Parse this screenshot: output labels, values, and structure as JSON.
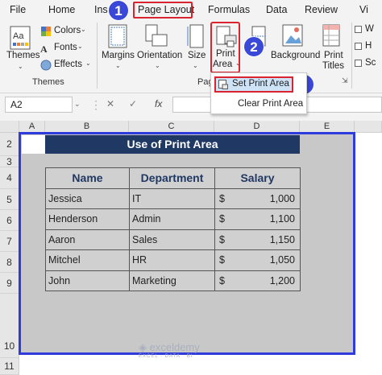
{
  "menu": {
    "items": [
      "File",
      "Home",
      "Ins",
      "Page Layout",
      "Formulas",
      "Data",
      "Review",
      "Vi"
    ],
    "active": "Page Layout"
  },
  "ribbon": {
    "themes": {
      "themes_label": "Themes",
      "colors_label": "Colors",
      "fonts_label": "Fonts",
      "effects_label": "Effects",
      "group_label": "Themes"
    },
    "page_setup": {
      "margins_label": "Margins",
      "orientation_label": "Orientation",
      "size_label": "Size",
      "print_area_line1": "Print",
      "print_area_line2": "Area",
      "background_label": "Background",
      "print_titles_line1": "Print",
      "print_titles_line2": "Titles",
      "group_label": "Pag"
    },
    "right_labels": [
      "W",
      "H",
      "Sc"
    ]
  },
  "badges": {
    "one": "1",
    "two": "2",
    "three": "3"
  },
  "dropdown": {
    "set_print_area": "Set Print Area",
    "clear_print_area": "Clear Print Area"
  },
  "formula_bar": {
    "name_box": "A2",
    "cancel_symbol": "✕",
    "enter_symbol": "✓",
    "fx_symbol": "fx",
    "formula": ""
  },
  "columns": [
    "A",
    "B",
    "C",
    "D",
    "E"
  ],
  "rows": [
    "2",
    "3",
    "4",
    "5",
    "6",
    "7",
    "8",
    "9",
    "10",
    "11"
  ],
  "sheet": {
    "title": "Use of Print Area",
    "headers": [
      "Name",
      "Department",
      "Salary"
    ],
    "records": [
      {
        "name": "Jessica",
        "department": "IT",
        "currency": "$",
        "salary": "1,000"
      },
      {
        "name": "Henderson",
        "department": "Admin",
        "currency": "$",
        "salary": "1,100"
      },
      {
        "name": "Aaron",
        "department": "Sales",
        "currency": "$",
        "salary": "1,150"
      },
      {
        "name": "Mitchel",
        "department": "HR",
        "currency": "$",
        "salary": "1,050"
      },
      {
        "name": "John",
        "department": "Marketing",
        "currency": "$",
        "salary": "1,200"
      }
    ]
  },
  "watermark": {
    "brand": "exceldemy",
    "tagline": "EXCEL · DATA · BI"
  },
  "colors": {
    "badge": "#3a48d8",
    "highlight": "#d9232e",
    "print_area_border": "#2f3bdb",
    "title_fill": "#203864",
    "header_text": "#203864"
  },
  "icons": [
    "themes-icon",
    "colors-icon",
    "fonts-icon",
    "effects-icon",
    "margins-icon",
    "orientation-icon",
    "size-icon",
    "print-area-icon",
    "background-icon",
    "print-titles-icon",
    "set-print-area-icon",
    "fx-icon"
  ]
}
